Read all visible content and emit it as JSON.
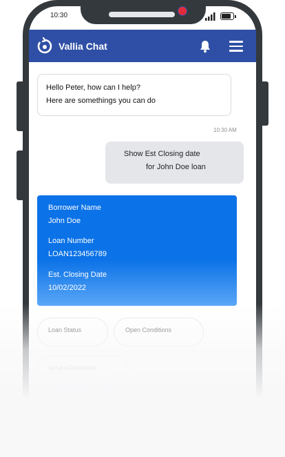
{
  "status_bar": {
    "time": "10:30"
  },
  "header": {
    "title": "Vallia Chat"
  },
  "chat": {
    "bot_message": {
      "line1": "Hello Peter, how can I help?",
      "line2": "Here are somethings you can do"
    },
    "time": "10:30 AM",
    "user_message": {
      "line1": "Show Est Closing date",
      "line2": "for John Doe loan"
    }
  },
  "loan_card": {
    "fields": [
      {
        "label": "Borrower Name",
        "value": "John Doe"
      },
      {
        "label": "Loan Number",
        "value": "LOAN123456789"
      },
      {
        "label": "Est. Closing Date",
        "value": "10/02/2022"
      }
    ]
  },
  "quick_replies": [
    "Loan Status",
    "Open Conditions",
    "Send eDisclosure"
  ],
  "colors": {
    "header": "#2f4fa6",
    "card": "#0b72e7",
    "badge": "#e32b3b",
    "frame": "#34393d"
  },
  "icons": {
    "logo": "chat-logo-icon",
    "notification": "bell-icon",
    "menu": "hamburger-menu-icon"
  }
}
